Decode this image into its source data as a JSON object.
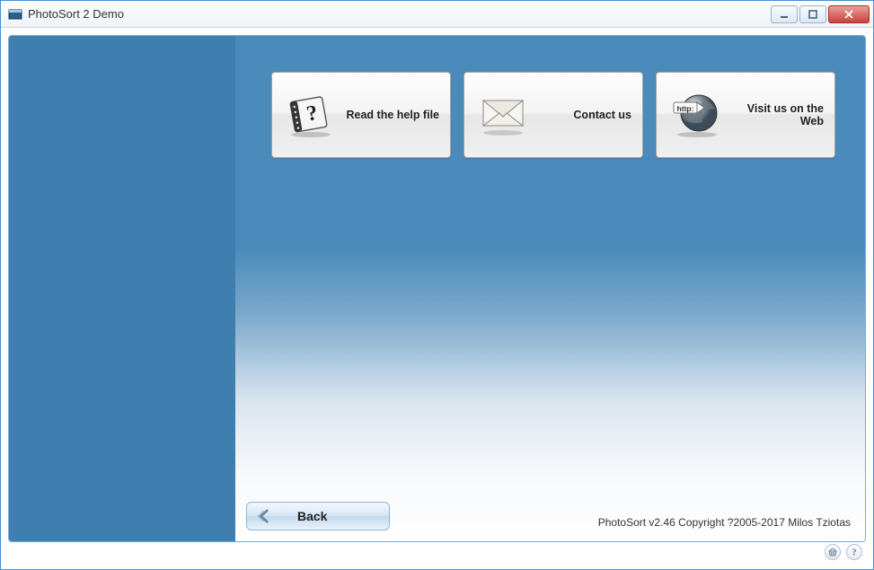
{
  "window": {
    "title": "PhotoSort 2 Demo"
  },
  "cards": {
    "help": {
      "label": "Read the help file"
    },
    "contact": {
      "label": "Contact us"
    },
    "web": {
      "label": "Visit us on the Web"
    }
  },
  "back": {
    "label": "Back"
  },
  "footer": {
    "copyright": "PhotoSort v2.46 Copyright ?2005-2017 Milos Tziotas"
  }
}
